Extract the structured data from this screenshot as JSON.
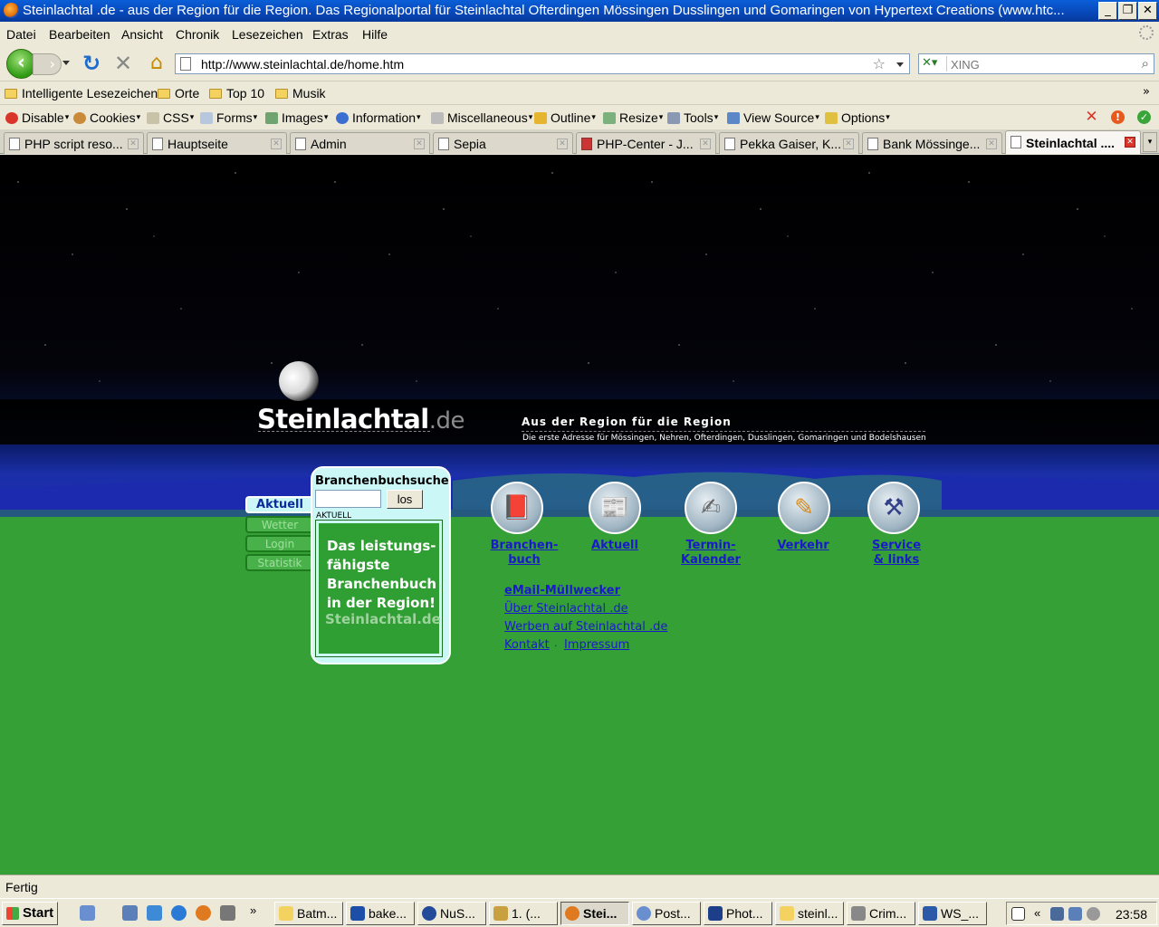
{
  "window": {
    "title": "Steinlachtal .de - aus der Region für die Region. Das Regionalportal für Steinlachtal Ofterdingen Mössingen Dusslingen und Gomaringen von Hypertext Creations (www.htc...",
    "minimize": "_",
    "restore": "❐",
    "close": "✕"
  },
  "menu": [
    "Datei",
    "Bearbeiten",
    "Ansicht",
    "Chronik",
    "Lesezeichen",
    "Extras",
    "Hilfe"
  ],
  "nav": {
    "back_icon": "arrow-left-icon",
    "url": "http://www.steinlachtal.de/home.htm",
    "search_placeholder": "XING",
    "bookmark_star": "☆",
    "search_glass": "⌕"
  },
  "bookmarks": {
    "items": [
      "Intelligente Lesezeichen",
      "Orte",
      "Top 10",
      "Musik"
    ],
    "more": "»"
  },
  "devbar": {
    "items": [
      "Disable",
      "Cookies",
      "CSS",
      "Forms",
      "Images",
      "Information",
      "Miscellaneous",
      "Outline",
      "Resize",
      "Tools",
      "View Source",
      "Options"
    ],
    "colors": {
      "error": "#d9352a",
      "warning": "#e65a1e",
      "ok": "#3aa53a"
    }
  },
  "tabs": [
    "PHP script reso...",
    "Hauptseite",
    "Admin",
    "Sepia",
    "PHP-Center - J...",
    "Pekka Gaiser, K...",
    "Bank Mössinge...",
    "Steinlachtal ...."
  ],
  "site": {
    "logo_main": "Steinlachtal",
    "logo_suffix": ".de",
    "tagline": "Aus der Region für die Region",
    "subtagline": "Die erste Adresse für Mössingen, Nehren, Ofterdingen, Dusslingen, Gomaringen und Bodelshausen",
    "side_nav": [
      "Aktuell",
      "Wetter",
      "Login",
      "Statistik"
    ],
    "search": {
      "title": "Branchenbuchsuche",
      "button": "los",
      "section_label": "AKTUELL",
      "promo_text": "Das leistungs-\nfähigste\nBranchenbuch\nin der Region!",
      "promo_brand": "Steinlachtal.de"
    },
    "icon_nav": [
      {
        "label": "Branchen-\nbuch",
        "icon": "book-tools-icon"
      },
      {
        "label": "Aktuell",
        "icon": "newspaper-icon"
      },
      {
        "label": "Termin-\nKalender",
        "icon": "calendar-pen-icon"
      },
      {
        "label": "Verkehr",
        "icon": "pencil-icon"
      },
      {
        "label": "Service\n& links",
        "icon": "toolbox-icon"
      }
    ],
    "links": [
      "eMail-Müllwecker",
      "Über Steinlachtal .de",
      "Werben auf Steinlachtal .de",
      "Kontakt",
      "Impressum"
    ],
    "link_separator": "·",
    "colors": {
      "ground": "#34a035",
      "panel": "#ccf7f7",
      "link": "#1a1acc"
    }
  },
  "status": "Fertig",
  "taskbar": {
    "start": "Start",
    "quick_launch_more": "»",
    "tasks": [
      "Batm...",
      "bake...",
      "NuS...",
      "1.  (...",
      "Stei...",
      "Post...",
      "Phot...",
      "steinl...",
      "Crim...",
      "WS_..."
    ],
    "tray_more": "«",
    "clock": "23:58"
  }
}
